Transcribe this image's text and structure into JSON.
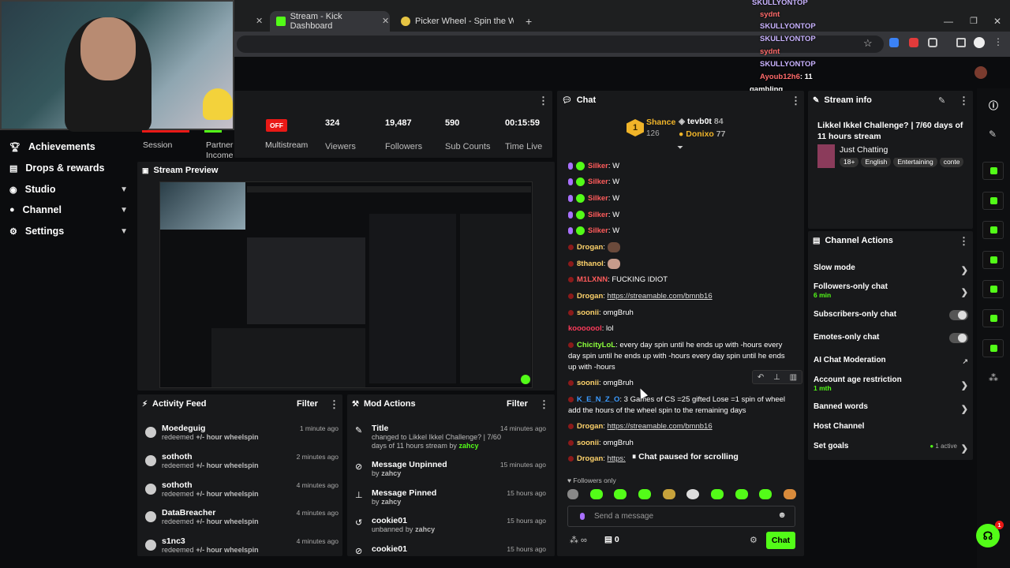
{
  "browser": {
    "tabs": [
      {
        "label": "Stream - Kick Dashboard",
        "active": true
      },
      {
        "label": "Picker Wheel - Spin the Wheel t",
        "active": false
      }
    ],
    "new_tab": "+"
  },
  "stream_overlay": {
    "chat_lines": [
      {
        "user": "SKULLYONTOP",
        "text": ":"
      },
      {
        "user": "sydnt",
        "text": ":"
      },
      {
        "user": "SKULLYONTOP",
        "text": ":"
      },
      {
        "user": "SKULLYONTOP",
        "text": ":"
      },
      {
        "user": "sydnt",
        "text": ":"
      },
      {
        "user": "SKULLYONTOP",
        "text": ":"
      },
      {
        "user": "Ayoub12h6",
        "text": ": 11"
      }
    ],
    "last_line": "gambling"
  },
  "nav": {
    "items": [
      {
        "label": "Achievements",
        "icon": "trophy-icon"
      },
      {
        "label": "Drops & rewards",
        "icon": "gift-icon"
      },
      {
        "label": "Studio",
        "icon": "camera-icon",
        "expand": true
      },
      {
        "label": "Channel",
        "icon": "person-icon",
        "expand": true
      },
      {
        "label": "Settings",
        "icon": "gear-icon",
        "expand": true
      }
    ]
  },
  "stats": {
    "session_label": "Session",
    "partner_label": "Partner Income",
    "multistream_badge": "OFF",
    "multistream_label": "Multistream",
    "viewers": "324",
    "viewers_label": "Viewers",
    "followers": "19,487",
    "followers_label": "Followers",
    "subs": "590",
    "subs_label": "Sub Counts",
    "time": "00:15:59",
    "time_label": "Time Live"
  },
  "preview": {
    "title": "Stream Preview"
  },
  "activity_feed": {
    "title": "Activity Feed",
    "filter": "Filter",
    "items": [
      {
        "name": "Moedeguig",
        "action": "redeemed",
        "reward": "+/- hour wheelspin",
        "time": "1 minute ago"
      },
      {
        "name": "sothoth",
        "action": "redeemed",
        "reward": "+/- hour wheelspin",
        "time": "2 minutes ago"
      },
      {
        "name": "sothoth",
        "action": "redeemed",
        "reward": "+/- hour wheelspin",
        "time": "4 minutes ago"
      },
      {
        "name": "DataBreacher",
        "action": "redeemed",
        "reward": "+/- hour wheelspin",
        "time": "4 minutes ago"
      },
      {
        "name": "s1nc3",
        "action": "redeemed",
        "reward": "+/- hour wheelspin",
        "time": "4 minutes ago"
      }
    ]
  },
  "mod_actions": {
    "title": "Mod Actions",
    "filter": "Filter",
    "items": [
      {
        "title": "Title",
        "line1": "changed to Likkel Ikkel Challenge? | 7/60 days of 11 hours stream",
        "by": "by",
        "who": "zahcy",
        "time": "14 minutes ago"
      },
      {
        "title": "Message Unpinned",
        "line1": "",
        "by": "by",
        "who": "zahcy",
        "time": "15 minutes ago"
      },
      {
        "title": "Message Pinned",
        "line1": "",
        "by": "by",
        "who": "zahcy",
        "time": "15 hours ago"
      },
      {
        "title": "cookie01",
        "line1": "unbanned",
        "by": "by",
        "who": "zahcy",
        "time": "15 hours ago"
      },
      {
        "title": "cookie01",
        "line1": "",
        "by": "",
        "who": "",
        "time": "15 hours ago"
      }
    ]
  },
  "chat": {
    "title": "Chat",
    "top": [
      {
        "rank": "1",
        "name": "Shance",
        "value": "126"
      },
      {
        "name": "tevb0t",
        "value": "84"
      },
      {
        "name": "Donixo",
        "value": "77"
      }
    ],
    "messages": [
      {
        "user": "Silker",
        "text": ": W",
        "color": "#ff5b5b"
      },
      {
        "user": "Silker",
        "text": ": W",
        "color": "#ff5b5b"
      },
      {
        "user": "Silker",
        "text": ": W",
        "color": "#ff5b5b"
      },
      {
        "user": "Silker",
        "text": ": W",
        "color": "#ff5b5b"
      },
      {
        "user": "Silker",
        "text": ": W",
        "color": "#ff5b5b"
      },
      {
        "user": "Drogan",
        "text": ":",
        "color": "#ffd36b"
      },
      {
        "user": "8thanol",
        "text": ":",
        "color": "#ffd36b"
      },
      {
        "user": "M1LXNN",
        "text": ": FUCKING IDIOT",
        "color": "#ff5b5b"
      },
      {
        "user": "Drogan",
        "text": ":",
        "link": "https://streamable.com/bmnb16",
        "color": "#ffd36b"
      },
      {
        "user": "soonii",
        "text": ": omgBruh",
        "color": "#ffd36b"
      },
      {
        "user": "kooooool",
        "text": ": lol",
        "color": "#ff3b5b"
      },
      {
        "user": "ChicityLoL",
        "text": ": every day spin until he ends up with -hours every day spin until he ends up with -hours every day spin until he ends up with -hours",
        "color": "#8cff3b"
      },
      {
        "user": "soonii",
        "text": ": omgBruh",
        "color": "#ffd36b"
      },
      {
        "user": "K_E_N_Z_O",
        "text": ": 3 Games of CS =25 gifted Lose =1 spin of wheel add the hours of the wheel spin to the remaining days",
        "color": "#3b9bff"
      },
      {
        "user": "Drogan",
        "text": ":",
        "link": "https://streamable.com/bmnb16",
        "color": "#ffd36b"
      },
      {
        "user": "soonii",
        "text": ": omgBruh",
        "color": "#ffd36b"
      },
      {
        "user": "Drogan",
        "text": ":",
        "link": "https:",
        "color": "#ffd36b"
      }
    ],
    "paused": "Chat paused for scrolling",
    "followers_only": "Followers only",
    "input_placeholder": "Send a message",
    "footer_count": "0",
    "send_label": "Chat"
  },
  "stream_info": {
    "title_label": "Stream info",
    "title": "Likkel Ikkel Challenge? | 7/60 days of 11 hours stream",
    "category": "Just Chatting",
    "tags": [
      "18+",
      "English",
      "Entertaining",
      "conte"
    ]
  },
  "channel_actions": {
    "title": "Channel Actions",
    "items": [
      {
        "label": "Slow mode",
        "sub": "",
        "ctl": "chevron"
      },
      {
        "label": "Followers-only chat",
        "sub": "6 min",
        "ctl": "chevron"
      },
      {
        "label": "Subscribers-only chat",
        "sub": "",
        "ctl": "toggle"
      },
      {
        "label": "Emotes-only chat",
        "sub": "",
        "ctl": "toggle"
      },
      {
        "label": "AI Chat Moderation",
        "sub": "",
        "ctl": "link"
      },
      {
        "label": "Account age restriction",
        "sub": "1 mth",
        "ctl": "chevron"
      },
      {
        "label": "Banned words",
        "sub": "",
        "ctl": "chevron"
      },
      {
        "label": "Host Channel",
        "sub": "",
        "ctl": "none"
      },
      {
        "label": "Set goals",
        "sub": "",
        "ctl": "chevron",
        "extra": "1 active"
      }
    ]
  },
  "colors": {
    "accent": "#53fc18",
    "panel": "#18191b",
    "bg": "#0b0c0e",
    "offline": "#e91916"
  },
  "notification_count": "1"
}
